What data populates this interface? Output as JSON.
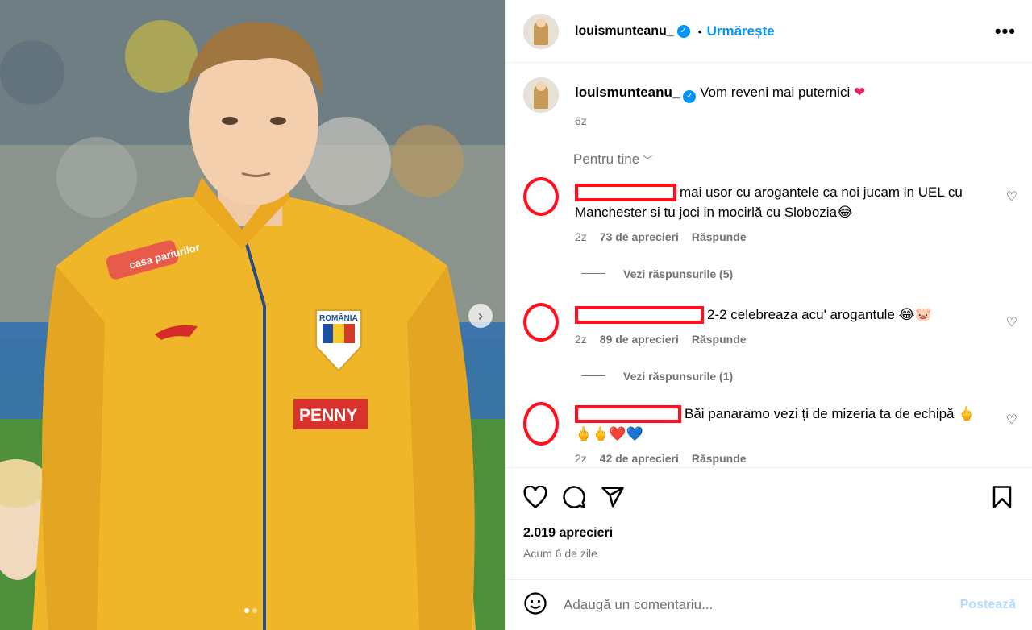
{
  "header": {
    "username": "louismunteanu_",
    "separator": "•",
    "follow_label": "Urmărește",
    "more_label": "•••"
  },
  "caption": {
    "username": "louismunteanu_",
    "text": "Vom reveni mai puternici",
    "emoji": "❤",
    "time": "6z"
  },
  "sort_label": "Pentru tine",
  "comments": [
    {
      "text": "mai usor cu arogantele ca noi jucam in UEL cu Manchester si tu joci in mocirlă cu Slobozia😂",
      "time": "2z",
      "likes": "73 de aprecieri",
      "reply": "Răspunde",
      "replies": "Vezi răspunsurile (5)"
    },
    {
      "text": "2-2 celebreaza acu' arogantule 😂🐷",
      "time": "2z",
      "likes": "89 de aprecieri",
      "reply": "Răspunde",
      "replies": "Vezi răspunsurile (1)"
    },
    {
      "text": "Băi panaramo vezi ți de mizeria ta de echipă 🖕🖕🖕❤️💙",
      "time": "2z",
      "likes": "42 de aprecieri",
      "reply": "Răspunde"
    }
  ],
  "likes_count": "2.019 aprecieri",
  "posted_ago": "Acum 6 de zile",
  "comment_input": {
    "placeholder": "Adaugă un comentariu..."
  },
  "post_label": "Postează",
  "photo": {
    "sponsor_chest": "PENNY",
    "crest_text": "ROMÂNIA",
    "shoulder_text": "casa pariurilor"
  },
  "colors": {
    "accent": "#0095f6",
    "annotation_red": "#ff0f1f",
    "jersey": "#f0b62a"
  }
}
